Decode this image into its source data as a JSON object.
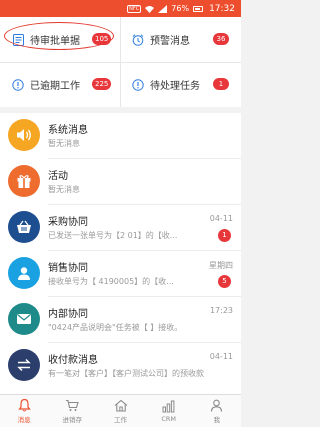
{
  "status_bar": {
    "battery": "76%",
    "time": "17:32",
    "nfc": "NFC"
  },
  "summary": [
    {
      "label": "待审批单据",
      "count": "105",
      "icon": "document-icon",
      "icon_color": "#2f7de1"
    },
    {
      "label": "预警消息",
      "count": "36",
      "icon": "alarm-clock-icon",
      "icon_color": "#2f7de1"
    },
    {
      "label": "已逾期工作",
      "count": "225",
      "icon": "alert-circle-icon",
      "icon_color": "#2f7de1"
    },
    {
      "label": "待处理任务",
      "count": "1",
      "icon": "alert-circle-icon",
      "icon_color": "#2f7de1"
    }
  ],
  "messages": [
    {
      "title": "系统消息",
      "subtitle": "暂无消息",
      "time": "",
      "badge": "",
      "icon": "speaker-icon",
      "color": "#f5a623"
    },
    {
      "title": "活动",
      "subtitle": "暂无消息",
      "time": "",
      "badge": "",
      "icon": "gift-icon",
      "color": "#ef6c2f"
    },
    {
      "title": "采购协同",
      "subtitle": "已发送一张单号为【2         01】的【收...",
      "time": "04-11",
      "badge": "1",
      "icon": "basket-icon",
      "color": "#1d4e8f"
    },
    {
      "title": "销售协同",
      "subtitle": "接收单号为【          4190005】的【收...",
      "time": "星期四",
      "badge": "5",
      "icon": "person-icon",
      "color": "#1aa1e2"
    },
    {
      "title": "内部协同",
      "subtitle": "\"0424产品说明会\"任务被【    】接收。",
      "time": "17:23",
      "badge": "",
      "icon": "mail-icon",
      "color": "#1e8b8a"
    },
    {
      "title": "收付款消息",
      "subtitle": "有一笔对【客户】【客户测试公司】的预收款",
      "time": "04-11",
      "badge": "",
      "icon": "exchange-icon",
      "color": "#2c3e6b"
    }
  ],
  "tabs": [
    {
      "label": "消息",
      "icon": "bell-icon",
      "active": true
    },
    {
      "label": "进销存",
      "icon": "cart-icon",
      "active": false
    },
    {
      "label": "工作",
      "icon": "home-icon",
      "active": false
    },
    {
      "label": "CRM",
      "icon": "chart-icon",
      "active": false
    },
    {
      "label": "我",
      "icon": "user-icon",
      "active": false
    }
  ],
  "colors": {
    "accent": "#ec4e2e",
    "badge": "#e8373b"
  }
}
